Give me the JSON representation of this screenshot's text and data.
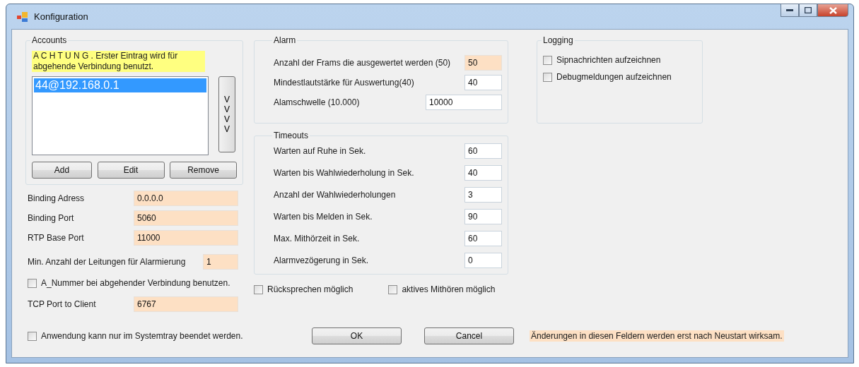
{
  "window": {
    "title": "Konfiguration"
  },
  "accounts": {
    "title": "Accounts",
    "notice": "A C H T U N G . Erster Eintrag wird für abgehende Verbindung benutzt.",
    "items": [
      {
        "label": "44@192.168.0.1",
        "selected": true
      }
    ],
    "move_button": "V V V V",
    "buttons": [
      "Add",
      "Edit",
      "Remove"
    ]
  },
  "left_items": [
    {
      "kind": "field",
      "label": "Binding Adress",
      "value": "0.0.0.0",
      "restart": true
    },
    {
      "kind": "field",
      "label": "Binding Port",
      "value": "5060",
      "restart": true
    },
    {
      "kind": "field",
      "label": "RTP Base Port",
      "value": "11000",
      "restart": true
    },
    {
      "kind": "short_field",
      "label": "Min. Anzahl der Leitungen für Alarmierung",
      "value": "1",
      "restart": true
    },
    {
      "kind": "checkbox",
      "label": "A_Nummer bei abgehender Verbindung benutzen.",
      "checked": false
    },
    {
      "kind": "field",
      "label": "TCP Port to Client",
      "value": "6767",
      "restart": true
    }
  ],
  "alarm": {
    "title": "Alarm",
    "fields": [
      {
        "kind": "short",
        "label": "Anzahl der Frams die ausgewertet werden (50)",
        "value": "50",
        "restart": true
      },
      {
        "kind": "short",
        "label": "Mindestlautstärke für Auswertung(40)",
        "value": "40",
        "restart": false
      },
      {
        "kind": "wide",
        "label": "Alamschwelle (10.000)",
        "value": "10000",
        "restart": false
      }
    ]
  },
  "timeouts": {
    "title": "Timeouts",
    "fields": [
      {
        "label": "Warten auf Ruhe in Sek.",
        "value": "60",
        "restart": false
      },
      {
        "label": "Warten bis Wahlwiederholung in Sek.",
        "value": "40",
        "restart": false
      },
      {
        "label": "Anzahl der Wahlwiederholungen",
        "value": "3",
        "restart": false
      },
      {
        "label": "Warten bis Melden in Sek.",
        "value": "90",
        "restart": false
      },
      {
        "label": "Max. Mithörzeit in Sek.",
        "value": "60",
        "restart": false
      },
      {
        "label": "Alarmvezögerung in Sek.",
        "value": "0",
        "restart": false
      }
    ]
  },
  "options": [
    {
      "label": "Rücksprechen möglich",
      "checked": false
    },
    {
      "label": "aktives Mithören möglich",
      "checked": false
    }
  ],
  "logging": {
    "title": "Logging",
    "options": [
      {
        "label": "Sipnachrichten aufzeichnen",
        "checked": false
      },
      {
        "label": "Debugmeldungen aufzeichnen",
        "checked": false
      }
    ]
  },
  "footer": {
    "tray_option": {
      "label": "Anwendung kann nur im Systemtray beendet werden.",
      "checked": false
    },
    "buttons": [
      "OK",
      "Cancel"
    ],
    "note": "Änderungen in diesen Feldern werden erst nach Neustart wirksam."
  }
}
